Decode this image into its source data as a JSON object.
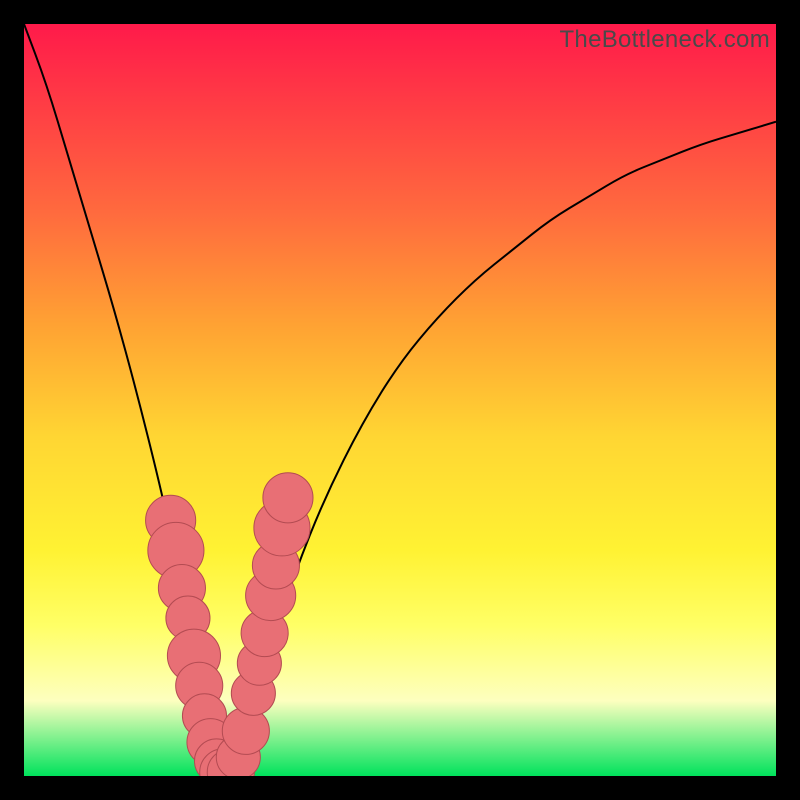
{
  "watermark": "TheBottleneck.com",
  "colors": {
    "marker_fill": "#e86f75",
    "marker_stroke": "#b34b52",
    "curve": "#000000",
    "gradient_top": "#ff1a4a",
    "gradient_bottom": "#00e25c"
  },
  "chart_data": {
    "type": "line",
    "title": "",
    "xlabel": "",
    "ylabel": "",
    "xlim": [
      0,
      100
    ],
    "ylim": [
      0,
      100
    ],
    "grid": false,
    "legend": false,
    "note": "Axes are implicit (no tick labels in image). x is horizontal 0–100 left→right, y is vertical 0–100 bottom→top. Two curves meet near x≈25 at y≈0 forming a V; left branch rises steeply toward top-left, right branch rises toward top-right and flattens.",
    "series": [
      {
        "name": "left_branch",
        "x": [
          0,
          3,
          6,
          9,
          12,
          15,
          18,
          20,
          22,
          24,
          25,
          26,
          27
        ],
        "y": [
          100,
          92,
          82,
          72,
          62,
          51,
          39,
          30,
          20,
          10,
          5,
          2,
          0
        ]
      },
      {
        "name": "right_branch",
        "x": [
          27,
          29,
          32,
          36,
          40,
          45,
          50,
          55,
          60,
          65,
          70,
          75,
          80,
          85,
          90,
          95,
          100
        ],
        "y": [
          0,
          5,
          15,
          27,
          37,
          47,
          55,
          61,
          66,
          70,
          74,
          77,
          80,
          82,
          84,
          85.5,
          87
        ]
      }
    ],
    "markers": {
      "name": "highlighted_points",
      "description": "Pink rounded blobs clustered near the valley bottom on both branches",
      "points": [
        {
          "x": 19.5,
          "y": 34,
          "r": 2.8
        },
        {
          "x": 20.2,
          "y": 30,
          "r": 3.2
        },
        {
          "x": 21.0,
          "y": 25,
          "r": 2.6
        },
        {
          "x": 21.8,
          "y": 21,
          "r": 2.4
        },
        {
          "x": 22.6,
          "y": 16,
          "r": 3.0
        },
        {
          "x": 23.3,
          "y": 12,
          "r": 2.6
        },
        {
          "x": 24.0,
          "y": 8,
          "r": 2.4
        },
        {
          "x": 24.8,
          "y": 4.5,
          "r": 2.6
        },
        {
          "x": 25.6,
          "y": 2,
          "r": 2.4
        },
        {
          "x": 26.5,
          "y": 0.5,
          "r": 2.6
        },
        {
          "x": 27.5,
          "y": 0.5,
          "r": 2.6
        },
        {
          "x": 28.5,
          "y": 2.5,
          "r": 2.4
        },
        {
          "x": 29.5,
          "y": 6,
          "r": 2.6
        },
        {
          "x": 30.5,
          "y": 11,
          "r": 2.4
        },
        {
          "x": 31.3,
          "y": 15,
          "r": 2.4
        },
        {
          "x": 32.0,
          "y": 19,
          "r": 2.6
        },
        {
          "x": 32.8,
          "y": 24,
          "r": 2.8
        },
        {
          "x": 33.5,
          "y": 28,
          "r": 2.6
        },
        {
          "x": 34.3,
          "y": 33,
          "r": 3.2
        },
        {
          "x": 35.1,
          "y": 37,
          "r": 2.8
        }
      ]
    }
  }
}
